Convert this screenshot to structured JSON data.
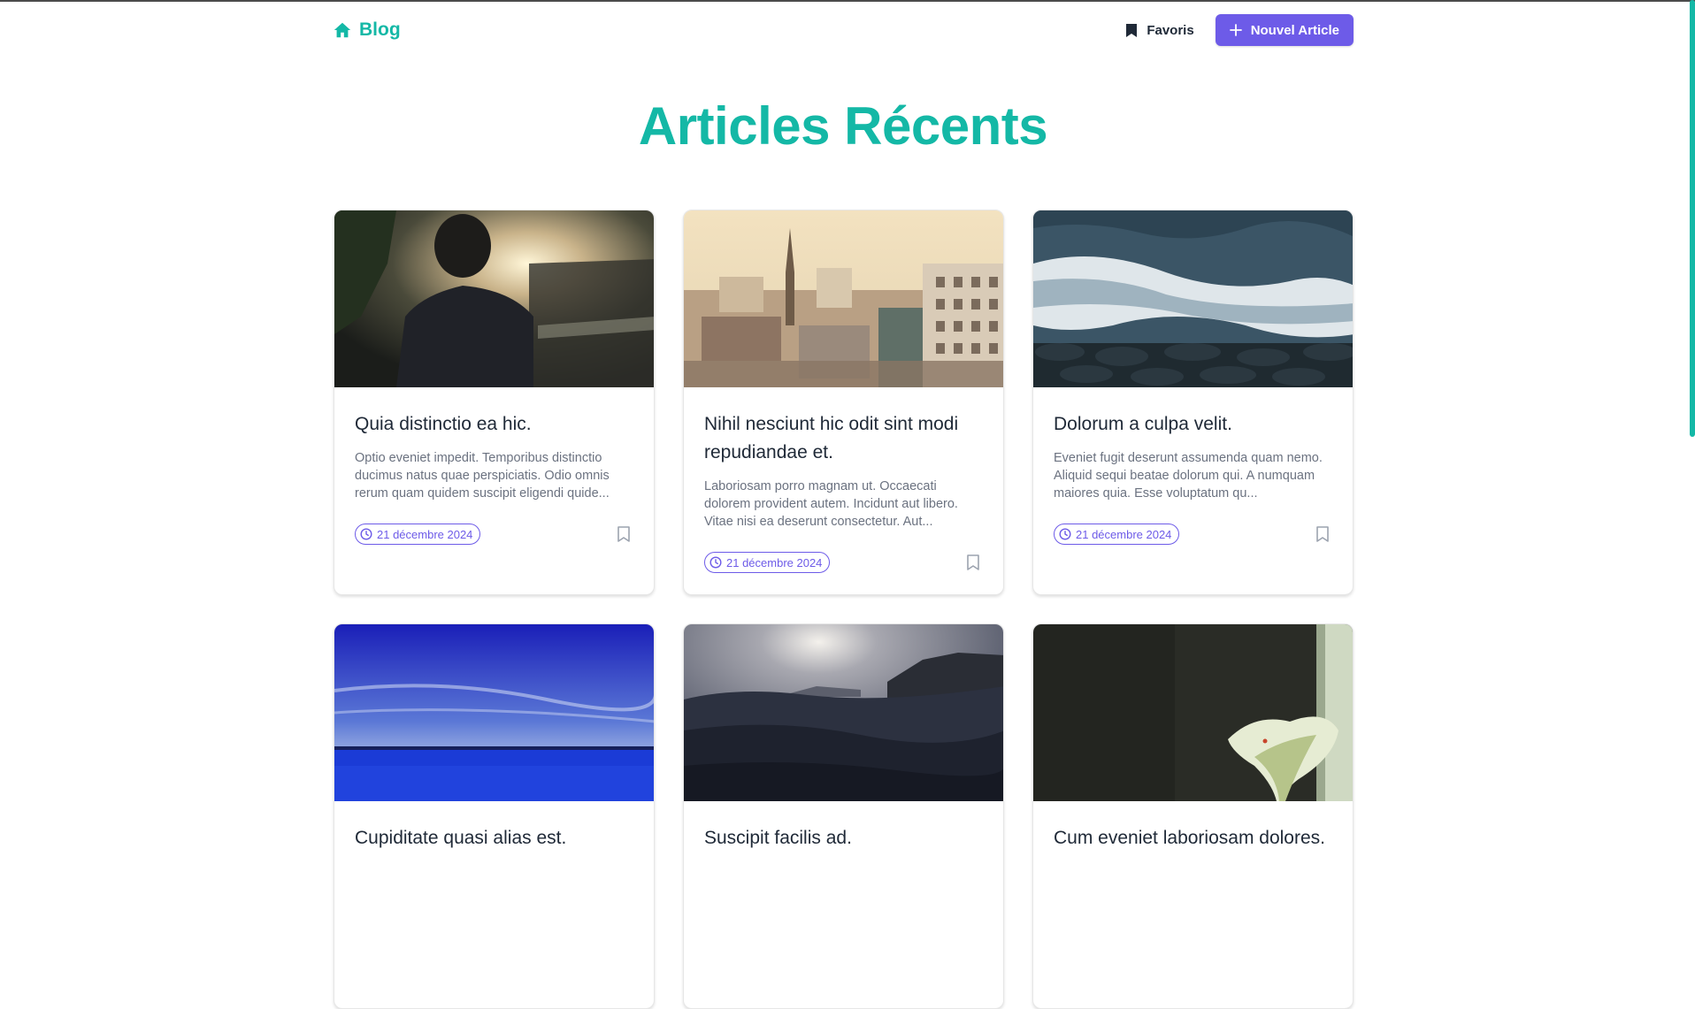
{
  "header": {
    "brand_label": "Blog",
    "brand_icon": "home-icon",
    "favoris_label": "Favoris",
    "favoris_icon": "bookmark-icon",
    "new_article_label": "Nouvel Article",
    "new_article_icon": "plus-icon"
  },
  "page_title": "Articles Récents",
  "colors": {
    "accent": "#14b8a6",
    "primary": "#6d5be8"
  },
  "articles": [
    {
      "title": "Quia distinctio ea hic.",
      "excerpt": "Optio eveniet impedit. Temporibus distinctio ducimus natus quae perspiciatis. Odio omnis rerum quam quidem suscipit eligendi quide...",
      "date": "21 décembre 2024",
      "image": "man-sunset-photo"
    },
    {
      "title": "Nihil nesciunt hic odit sint modi repudiandae et.",
      "excerpt": "Laboriosam porro magnam ut. Occaecati dolorem provident autem. Incidunt aut libero. Vitae nisi ea deserunt consectetur. Aut...",
      "date": "21 décembre 2024",
      "image": "city-church-photo"
    },
    {
      "title": "Dolorum a culpa velit.",
      "excerpt": "Eveniet fugit deserunt assumenda quam nemo. Aliquid sequi beatae dolorum qui. A numquam maiores quia. Esse voluptatum qu...",
      "date": "21 décembre 2024",
      "image": "ocean-waves-photo"
    },
    {
      "title": "Cupiditate quasi alias est.",
      "excerpt": "",
      "date": "",
      "image": "blue-sky-lake-photo"
    },
    {
      "title": "Suscipit facilis ad.",
      "excerpt": "",
      "date": "",
      "image": "dark-sea-photo"
    },
    {
      "title": "Cum eveniet laboriosam dolores.",
      "excerpt": "",
      "date": "",
      "image": "calla-lily-photo"
    }
  ]
}
